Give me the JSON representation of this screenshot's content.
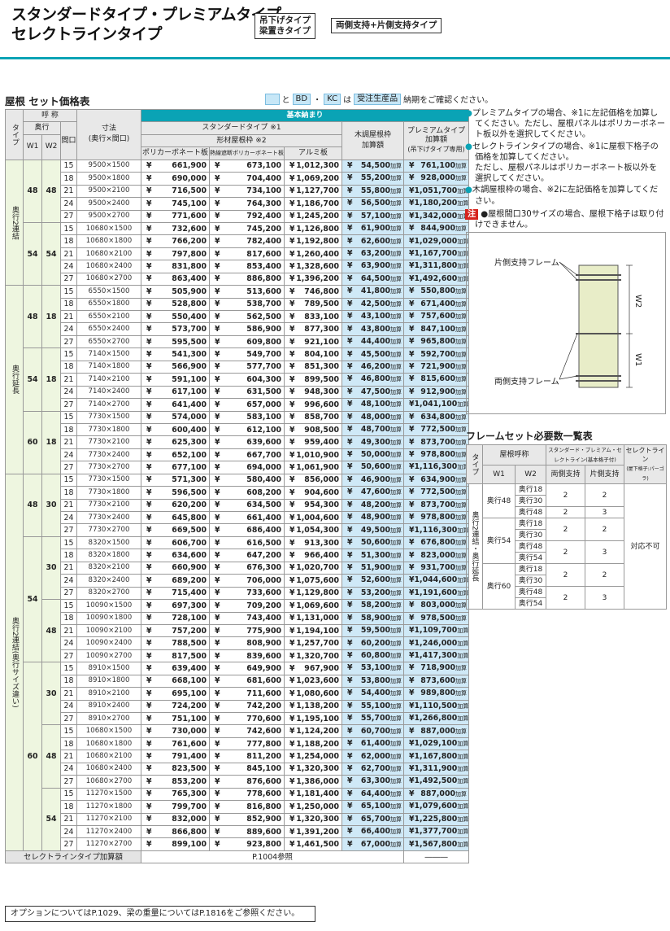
{
  "header": {
    "title_line1": "スタンダードタイプ・プレミアムタイプ",
    "title_line2": "セレクトラインタイプ",
    "tag1_line1": "吊下げタイプ",
    "tag1_line2": "梁置きタイプ",
    "tag2": "両側支持+片側支持タイプ"
  },
  "section_title": "屋根 セット価格表",
  "legend": {
    "and": "と",
    "bd": "BD",
    "dot": "・",
    "kc": "KC",
    "ha": "は",
    "juchu": "受注生産品",
    "suffix": "納期をご確認ください。"
  },
  "table": {
    "h_type": "タイプ",
    "h_yobi": "呼 称",
    "h_okuyuki": "奥行",
    "h_w1": "W1",
    "h_w2": "W2",
    "h_maguchi": "間口",
    "h_sunpo": "寸法",
    "h_sunpo2": "(奥行×間口)",
    "h_kihon": "基本納まり",
    "h_standard": "スタンダードタイプ ※1",
    "h_katazai": "形材屋根枠 ※2",
    "h_poly": "ポリカーボネート板",
    "h_netsu": "熱線遮断ポリカーボネート板",
    "h_alumi": "アルミ板",
    "h_mokume1": "木調屋根枠",
    "h_mokume2": "加算額",
    "h_premium1": "プレミアムタイプ",
    "h_premium2": "加算額",
    "h_premium3": "(吊下げタイプ専用)",
    "kasan": "加算",
    "yen": "¥",
    "type_labels": [
      "奥行2連結",
      "奥行延長",
      "奥行2連結(奥行サイズ違い)"
    ],
    "groups": [
      {
        "w1": "48",
        "w2": "48",
        "rows": [
          [
            "15",
            "9500×1500",
            "661,900",
            "673,100",
            "1,012,300",
            "54,500",
            "761,100"
          ],
          [
            "18",
            "9500×1800",
            "690,000",
            "704,400",
            "1,069,200",
            "55,200",
            "928,000"
          ],
          [
            "21",
            "9500×2100",
            "716,500",
            "734,100",
            "1,127,700",
            "55,800",
            "1,051,700"
          ],
          [
            "24",
            "9500×2400",
            "745,100",
            "764,300",
            "1,186,700",
            "56,500",
            "1,180,200"
          ],
          [
            "27",
            "9500×2700",
            "771,600",
            "792,400",
            "1,245,200",
            "57,100",
            "1,342,000"
          ]
        ]
      },
      {
        "w1": "54",
        "w2": "54",
        "rows": [
          [
            "15",
            "10680×1500",
            "732,600",
            "745,200",
            "1,126,800",
            "61,900",
            "844,900"
          ],
          [
            "18",
            "10680×1800",
            "766,200",
            "782,400",
            "1,192,800",
            "62,600",
            "1,029,000"
          ],
          [
            "21",
            "10680×2100",
            "797,800",
            "817,600",
            "1,260,400",
            "63,200",
            "1,167,700"
          ],
          [
            "24",
            "10680×2400",
            "831,800",
            "853,400",
            "1,328,600",
            "63,900",
            "1,311,800"
          ],
          [
            "27",
            "10680×2700",
            "863,400",
            "886,800",
            "1,396,200",
            "64,500",
            "1,492,600"
          ]
        ]
      },
      {
        "w1": "48",
        "w2": "18",
        "rows": [
          [
            "15",
            "6550×1500",
            "505,900",
            "513,600",
            "746,800",
            "41,800",
            "550,800"
          ],
          [
            "18",
            "6550×1800",
            "528,800",
            "538,700",
            "789,500",
            "42,500",
            "671,400"
          ],
          [
            "21",
            "6550×2100",
            "550,400",
            "562,500",
            "833,100",
            "43,100",
            "757,600"
          ],
          [
            "24",
            "6550×2400",
            "573,700",
            "586,900",
            "877,300",
            "43,800",
            "847,100"
          ],
          [
            "27",
            "6550×2700",
            "595,500",
            "609,800",
            "921,100",
            "44,400",
            "965,800"
          ]
        ]
      },
      {
        "w1": "54",
        "w2": "18",
        "rows": [
          [
            "15",
            "7140×1500",
            "541,300",
            "549,700",
            "804,100",
            "45,500",
            "592,700"
          ],
          [
            "18",
            "7140×1800",
            "566,900",
            "577,700",
            "851,300",
            "46,200",
            "721,900"
          ],
          [
            "21",
            "7140×2100",
            "591,100",
            "604,300",
            "899,500",
            "46,800",
            "815,600"
          ],
          [
            "24",
            "7140×2400",
            "617,100",
            "631,500",
            "948,300",
            "47,500",
            "912,900"
          ],
          [
            "27",
            "7140×2700",
            "641,400",
            "657,000",
            "996,600",
            "48,100",
            "1,041,100"
          ]
        ]
      },
      {
        "w1": "60",
        "w2": "18",
        "rows": [
          [
            "15",
            "7730×1500",
            "574,000",
            "583,100",
            "858,700",
            "48,000",
            "634,800"
          ],
          [
            "18",
            "7730×1800",
            "600,400",
            "612,100",
            "908,500",
            "48,700",
            "772,500"
          ],
          [
            "21",
            "7730×2100",
            "625,300",
            "639,600",
            "959,400",
            "49,300",
            "873,700"
          ],
          [
            "24",
            "7730×2400",
            "652,100",
            "667,700",
            "1,010,900",
            "50,000",
            "978,800"
          ],
          [
            "27",
            "7730×2700",
            "677,100",
            "694,000",
            "1,061,900",
            "50,600",
            "1,116,300"
          ]
        ]
      },
      {
        "w1": "48",
        "w2": "30",
        "rows": [
          [
            "15",
            "7730×1500",
            "571,300",
            "580,400",
            "856,000",
            "46,900",
            "634,900"
          ],
          [
            "18",
            "7730×1800",
            "596,500",
            "608,200",
            "904,600",
            "47,600",
            "772,500"
          ],
          [
            "21",
            "7730×2100",
            "620,200",
            "634,500",
            "954,300",
            "48,200",
            "873,700"
          ],
          [
            "24",
            "7730×2400",
            "645,800",
            "661,400",
            "1,004,600",
            "48,900",
            "978,800"
          ],
          [
            "27",
            "7730×2700",
            "669,500",
            "686,400",
            "1,054,300",
            "49,500",
            "1,116,300"
          ]
        ]
      },
      {
        "w1": "54",
        "w2": "30",
        "rows": [
          [
            "15",
            "8320×1500",
            "606,700",
            "616,500",
            "913,300",
            "50,600",
            "676,800"
          ],
          [
            "18",
            "8320×1800",
            "634,600",
            "647,200",
            "966,400",
            "51,300",
            "823,000"
          ],
          [
            "21",
            "8320×2100",
            "660,900",
            "676,300",
            "1,020,700",
            "51,900",
            "931,700"
          ],
          [
            "24",
            "8320×2400",
            "689,200",
            "706,000",
            "1,075,600",
            "52,600",
            "1,044,600"
          ],
          [
            "27",
            "8320×2700",
            "715,400",
            "733,600",
            "1,129,800",
            "53,200",
            "1,191,600"
          ]
        ]
      },
      {
        "w1": "54",
        "w2": "48",
        "rows": [
          [
            "15",
            "10090×1500",
            "697,300",
            "709,200",
            "1,069,600",
            "58,200",
            "803,000"
          ],
          [
            "18",
            "10090×1800",
            "728,100",
            "743,400",
            "1,131,000",
            "58,900",
            "978,500"
          ],
          [
            "21",
            "10090×2100",
            "757,200",
            "775,900",
            "1,194,100",
            "59,500",
            "1,109,700"
          ],
          [
            "24",
            "10090×2400",
            "788,500",
            "808,900",
            "1,257,700",
            "60,200",
            "1,246,000"
          ],
          [
            "27",
            "10090×2700",
            "817,500",
            "839,600",
            "1,320,700",
            "60,800",
            "1,417,300"
          ]
        ]
      },
      {
        "w1": "60",
        "w2": "30",
        "rows": [
          [
            "15",
            "8910×1500",
            "639,400",
            "649,900",
            "967,900",
            "53,100",
            "718,900"
          ],
          [
            "18",
            "8910×1800",
            "668,100",
            "681,600",
            "1,023,600",
            "53,800",
            "873,600"
          ],
          [
            "21",
            "8910×2100",
            "695,100",
            "711,600",
            "1,080,600",
            "54,400",
            "989,800"
          ],
          [
            "24",
            "8910×2400",
            "724,200",
            "742,200",
            "1,138,200",
            "55,100",
            "1,110,500"
          ],
          [
            "27",
            "8910×2700",
            "751,100",
            "770,600",
            "1,195,100",
            "55,700",
            "1,266,800"
          ]
        ]
      },
      {
        "w1": "60",
        "w2": "48",
        "rows": [
          [
            "15",
            "10680×1500",
            "730,000",
            "742,600",
            "1,124,200",
            "60,700",
            "887,000"
          ],
          [
            "18",
            "10680×1800",
            "761,600",
            "777,800",
            "1,188,200",
            "61,400",
            "1,029,100"
          ],
          [
            "21",
            "10680×2100",
            "791,400",
            "811,200",
            "1,254,000",
            "62,000",
            "1,167,800"
          ],
          [
            "24",
            "10680×2400",
            "823,500",
            "845,100",
            "1,320,300",
            "62,700",
            "1,311,900"
          ],
          [
            "27",
            "10680×2700",
            "853,200",
            "876,600",
            "1,386,000",
            "63,300",
            "1,492,500"
          ]
        ]
      },
      {
        "w1": "60",
        "w2": "54",
        "rows": [
          [
            "15",
            "11270×1500",
            "765,300",
            "778,600",
            "1,181,400",
            "64,400",
            "887,000"
          ],
          [
            "18",
            "11270×1800",
            "799,700",
            "816,800",
            "1,250,000",
            "65,100",
            "1,079,600"
          ],
          [
            "21",
            "11270×2100",
            "832,000",
            "852,900",
            "1,320,300",
            "65,700",
            "1,225,800"
          ],
          [
            "24",
            "11270×2400",
            "866,800",
            "889,600",
            "1,391,200",
            "66,400",
            "1,377,700"
          ],
          [
            "27",
            "11270×2700",
            "899,100",
            "923,800",
            "1,461,500",
            "67,000",
            "1,567,800"
          ]
        ]
      }
    ],
    "select_label": "セレクトラインタイプ加算額",
    "select_ref": "P.1004参照",
    "select_premium": "―――"
  },
  "notes": {
    "n1": "プレミアムタイプの場合、※1に左記価格を加算してください。ただし、屋根パネルはポリカーボネート板以外を選択してください。",
    "n2": "セレクトラインタイプの場合、※1に屋根下格子の価格を加算してください。",
    "n2b": "ただし、屋根パネルはポリカーボネート板以外を選択してください。",
    "n3": "木調屋根枠の場合、※2に左記価格を加算してください。",
    "chu": "注",
    "n4": "屋根間口30サイズの場合、屋根下格子は取り付けできません。"
  },
  "diagram": {
    "katagawa": "片側支持フレーム",
    "ryogawa": "両側支持フレーム",
    "w2": "W2",
    "w1": "W1"
  },
  "frame_table": {
    "title": "フレームセット必要数一覧表",
    "h_type": "タイプ",
    "h_yane": "屋根呼称",
    "h_std": "スタンダード・プレミアム・セレクトライン(基本格子付)",
    "h_select": "セレクトライン",
    "h_select2": "(屋下格子:パーゴラ)",
    "h_w1": "W1",
    "h_w2": "W2",
    "h_ryo": "両側支持",
    "h_kata": "片側支持",
    "type_label": "奥行2連結・奥行延長",
    "rows": [
      {
        "w1": "奥行48",
        "w2": [
          "奥行18",
          "奥行30",
          "奥行48"
        ],
        "a": [
          "2",
          "2"
        ],
        "b": [
          "2",
          "3"
        ]
      },
      {
        "w1": "奥行54",
        "w2": [
          "奥行18",
          "奥行30",
          "奥行48",
          "奥行54"
        ],
        "a": [
          "2",
          "2"
        ],
        "b": [
          "2",
          "3"
        ]
      },
      {
        "w1": "奥行60",
        "w2": [
          "奥行18",
          "奥行30",
          "奥行48",
          "奥行54"
        ],
        "a": [
          "2",
          "2"
        ],
        "b": [
          "2",
          "3"
        ]
      }
    ],
    "not_applicable": "対応不可"
  },
  "footer": "オプションについてはP.1029、梁の重量についてはP.1816をご参照ください。",
  "colors": {
    "accent": "#0aa3b5",
    "blue_cell": "#cfe9f7",
    "type_bg": "#eef6e0"
  }
}
